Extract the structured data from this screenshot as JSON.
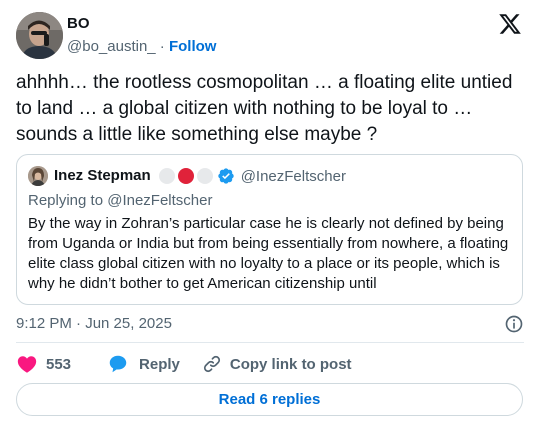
{
  "author": {
    "display_name": "BO",
    "handle": "@bo_austin_",
    "separator": "·",
    "follow_label": "Follow"
  },
  "tweet": {
    "text": "ahhhh… the rootless cosmopolitan … a floating elite untied to land … a global citizen with nothing to be loyal to … sounds a little like something else maybe ?"
  },
  "quote": {
    "display_name": "Inez Stepman",
    "handle": "@InezFeltscher",
    "replying_to": "Replying to @InezFeltscher",
    "text": "By the way in Zohran’s particular case he is clearly not defined by being from Uganda or India but from being essentially from nowhere, a floating elite class global citizen with no loyalty to a place or its people, which is why he didn’t bother to get American citizenship until"
  },
  "meta": {
    "timestamp": "9:12 PM · Jun 25, 2025"
  },
  "actions": {
    "like_count": "553",
    "reply_label": "Reply",
    "copy_label": "Copy link to post"
  },
  "footer": {
    "read_replies_label": "Read 6 replies"
  },
  "icons": {
    "logo": "x-logo-icon",
    "like": "heart-icon",
    "reply": "speech-bubble-icon",
    "copy": "link-icon",
    "info": "info-icon",
    "verified": "verified-badge-icon"
  },
  "colors": {
    "link_blue": "#006fd6",
    "like_pink": "#f91880",
    "reply_blue": "#1d9bf0",
    "muted_text": "#536471",
    "border": "#cfd9de",
    "flag_red": "#e0223a"
  }
}
